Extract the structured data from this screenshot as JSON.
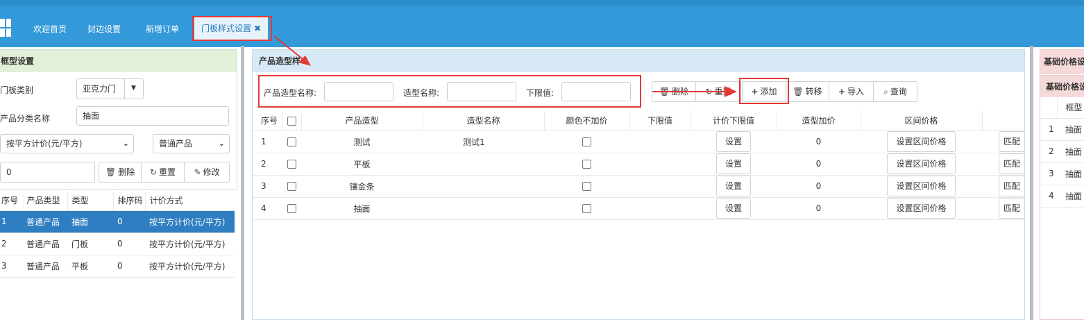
{
  "tabs": [
    {
      "label": "欢迎首页"
    },
    {
      "label": "封边设置"
    },
    {
      "label": "新增订单"
    },
    {
      "label": "门板样式设置",
      "close": "✖"
    }
  ],
  "left_panel": {
    "title": "框型设置",
    "door_category_label": "门板类别",
    "door_category_value": "亚克力门",
    "product_class_label": "产品分类名称",
    "product_class_value": "抽面",
    "pricing_select_value": "按平方计价(元/平方)",
    "product_type_select_value": "普通产品",
    "sort_input_value": "0",
    "delete_label": "删除",
    "reset_label": "重置",
    "edit_label": "修改",
    "columns": [
      "序号",
      "产品类型",
      "类型",
      "排序码",
      "计价方式"
    ],
    "rows": [
      {
        "no": "1",
        "ptype": "普通产品",
        "kind": "抽面",
        "sort": "0",
        "pricing": "按平方计价(元/平方)"
      },
      {
        "no": "2",
        "ptype": "普通产品",
        "kind": "门板",
        "sort": "0",
        "pricing": "按平方计价(元/平方)"
      },
      {
        "no": "3",
        "ptype": "普通产品",
        "kind": "平板",
        "sort": "0",
        "pricing": "按平方计价(元/平方)"
      }
    ]
  },
  "middle_panel": {
    "title": "产品造型样",
    "model_name_label": "产品造型名称:",
    "shape_name_label": "造型名称:",
    "lower_limit_label": "下限值:",
    "delete_label": "删除",
    "reset_label": "重置",
    "add_label": "添加",
    "transfer_label": "转移",
    "import_label": "导入",
    "query_label": "查询",
    "columns": [
      "序号",
      "产品造型",
      "造型名称",
      "颜色不加价",
      "下限值",
      "计价下限值",
      "造型加价",
      "区间价格"
    ],
    "set_label": "设置",
    "set_range_label": "设置区间价格",
    "match_label": "匹配",
    "rows": [
      {
        "no": "1",
        "model": "测试",
        "shape": "测试1",
        "markup": "0"
      },
      {
        "no": "2",
        "model": "平板",
        "shape": "",
        "markup": "0"
      },
      {
        "no": "3",
        "model": "镶金条",
        "shape": "",
        "markup": "0"
      },
      {
        "no": "4",
        "model": "抽面",
        "shape": "",
        "markup": "0"
      }
    ]
  },
  "right_panel": {
    "title": "基础价格设",
    "subtitle": "基础价格设",
    "column": "框型",
    "rows": [
      {
        "no": "1",
        "frame": "抽面"
      },
      {
        "no": "2",
        "frame": "抽面"
      },
      {
        "no": "3",
        "frame": "抽面"
      },
      {
        "no": "4",
        "frame": "抽面"
      }
    ]
  },
  "colors": {
    "header": "#3399d9",
    "accent": "#e53935",
    "selected": "#2f7ec1"
  }
}
